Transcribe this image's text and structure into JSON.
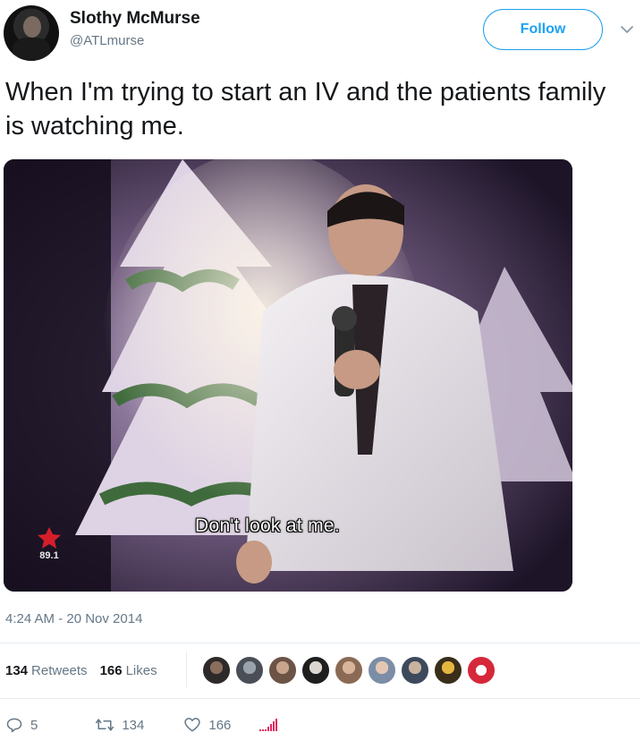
{
  "tweet": {
    "author": {
      "display_name": "Slothy McMurse",
      "handle": "@ATLmurse"
    },
    "follow_label": "Follow",
    "text": "When I'm trying to start an IV and the patients family is watching me.",
    "media": {
      "subtitle": "Don't look at me.",
      "station_watermark": "89.1"
    },
    "timestamp": "4:24 AM - 20 Nov 2014",
    "stats": {
      "retweets": {
        "count": "134",
        "label": "Retweets"
      },
      "likes": {
        "count": "166",
        "label": "Likes"
      }
    },
    "liker_avatars": [
      "liker-1",
      "liker-2",
      "liker-3",
      "liker-4",
      "liker-5",
      "liker-6",
      "liker-7",
      "liker-8",
      "liker-9"
    ],
    "actions": {
      "reply": {
        "icon": "reply-icon",
        "count": "5"
      },
      "retweet": {
        "icon": "retweet-icon",
        "count": "134"
      },
      "like": {
        "icon": "heart-icon",
        "count": "166"
      },
      "analytics": {
        "icon": "analytics-icon"
      }
    }
  },
  "colors": {
    "accent": "#1da1f2",
    "secondary_text": "#657786",
    "analytics": "#e0245e"
  }
}
